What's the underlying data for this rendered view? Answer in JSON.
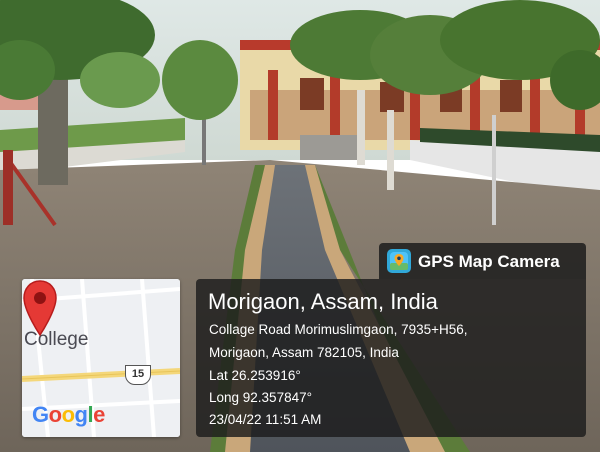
{
  "photo": {
    "description_icon": "campus-walkway-photo"
  },
  "map": {
    "place_label": "College",
    "route_number": "15",
    "logo": [
      "G",
      "o",
      "o",
      "g",
      "l",
      "e"
    ],
    "logo_colors": [
      "#4285F4",
      "#EA4335",
      "#FBBC05",
      "#4285F4",
      "#34A853",
      "#EA4335"
    ],
    "pin_icon": "map-pin-icon",
    "pin_color": "#e53935"
  },
  "app": {
    "name": "GPS Map Camera",
    "icon": "gps-map-camera-icon"
  },
  "info": {
    "title": "Morigaon, Assam, India",
    "address_line1": "Collage Road Morimuslimgaon, 7935+H56,",
    "address_line2": "Morigaon, Assam 782105, India",
    "lat": "Lat 26.253916°",
    "long": "Long 92.357847°",
    "datetime": "23/04/22 11:51 AM"
  }
}
